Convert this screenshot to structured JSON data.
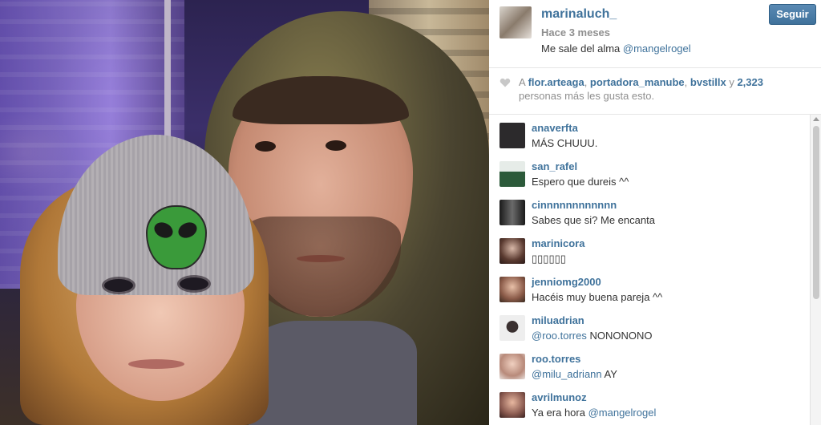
{
  "post": {
    "author": "marinaluch_",
    "time": "Hace 3 meses",
    "caption_text": "Me sale del alma",
    "caption_mention": "@mangelrogel",
    "follow_label": "Seguir",
    "accent_color": "#3f729b"
  },
  "likes": {
    "prefix": "A",
    "user1": "flor.arteaga",
    "user2": "portadora_manube",
    "user3": "bvstillx",
    "joiner": "y",
    "count": "2,323",
    "suffix": "personas más les gusta esto."
  },
  "comments": [
    {
      "user": "anaverfta",
      "mention": "",
      "text": "MÁS CHUUU.",
      "avatar_color": "#2c2a2c"
    },
    {
      "user": "san_rafel",
      "mention": "",
      "text": "Espero que dureis ^^",
      "avatar_color": "#4f6a56"
    },
    {
      "user": "cinnnnnnnnnnnn",
      "mention": "",
      "text": "Sabes que si? Me encanta",
      "avatar_color": "#4a4a4a"
    },
    {
      "user": "marinicora",
      "mention": "",
      "text": "▯▯▯▯▯▯",
      "avatar_color": "#6a5a50"
    },
    {
      "user": "jenniomg2000",
      "mention": "",
      "text": "Hacéis muy buena pareja ^^",
      "avatar_color": "#7a5a4a"
    },
    {
      "user": "miluadrian",
      "mention": "@roo.torres",
      "text": "NONONONO",
      "avatar_color": "#d8d2cc"
    },
    {
      "user": "roo.torres",
      "mention": "@milu_adriann",
      "text": "AY",
      "avatar_color": "#b88a7a"
    },
    {
      "user": "avrilmunoz",
      "mention": "",
      "text": "Ya era hora",
      "mention_after": "@mangelrogel",
      "avatar_color": "#8a5a50"
    }
  ]
}
